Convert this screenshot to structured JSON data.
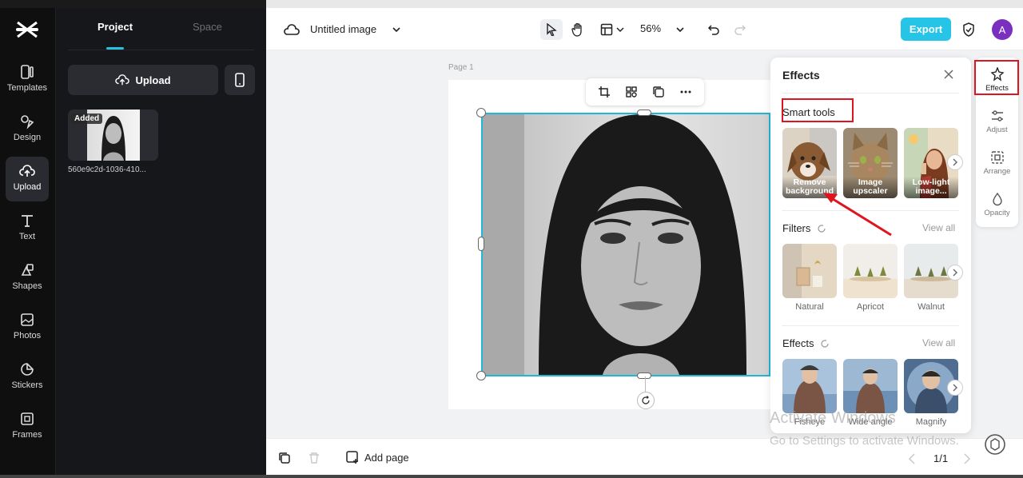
{
  "app": {
    "logo": "capcut-logo"
  },
  "rail": [
    {
      "label": "Templates",
      "icon": "templates-icon"
    },
    {
      "label": "Design",
      "icon": "design-icon"
    },
    {
      "label": "Upload",
      "icon": "upload-icon",
      "active": true
    },
    {
      "label": "Text",
      "icon": "text-icon"
    },
    {
      "label": "Shapes",
      "icon": "shapes-icon"
    },
    {
      "label": "Photos",
      "icon": "photos-icon"
    },
    {
      "label": "Stickers",
      "icon": "stickers-icon"
    },
    {
      "label": "Frames",
      "icon": "frames-icon"
    }
  ],
  "panel": {
    "tabs": [
      "Project",
      "Space"
    ],
    "upload_label": "Upload",
    "asset": {
      "badge": "Added",
      "name": "560e9c2d-1036-410..."
    }
  },
  "header": {
    "title": "Untitled image",
    "zoom": "56%",
    "export_label": "Export",
    "avatar_letter": "A"
  },
  "canvas": {
    "page_label": "Page 1"
  },
  "footer": {
    "add_page": "Add page",
    "pager": "1/1"
  },
  "effects_panel": {
    "title": "Effects",
    "smart_tools": {
      "title": "Smart tools",
      "items": [
        "Remove background",
        "Image upscaler",
        "Low-light image..."
      ]
    },
    "filters": {
      "title": "Filters",
      "view_all": "View all",
      "items": [
        "Natural",
        "Apricot",
        "Walnut"
      ]
    },
    "effects": {
      "title": "Effects",
      "view_all": "View all",
      "items": [
        "Fisheye",
        "Wide angle",
        "Magnify"
      ]
    }
  },
  "right_tools": [
    {
      "label": "Effects",
      "icon": "effects-icon",
      "active": true
    },
    {
      "label": "Adjust",
      "icon": "adjust-icon"
    },
    {
      "label": "Arrange",
      "icon": "arrange-icon"
    },
    {
      "label": "Opacity",
      "icon": "opacity-icon"
    }
  ],
  "watermark": {
    "line1": "Activate Windows",
    "line2": "Go to Settings to activate Windows."
  },
  "colors": {
    "accent": "#26c5e8",
    "highlight": "#e0141e",
    "avatar": "#7b2fbf"
  }
}
